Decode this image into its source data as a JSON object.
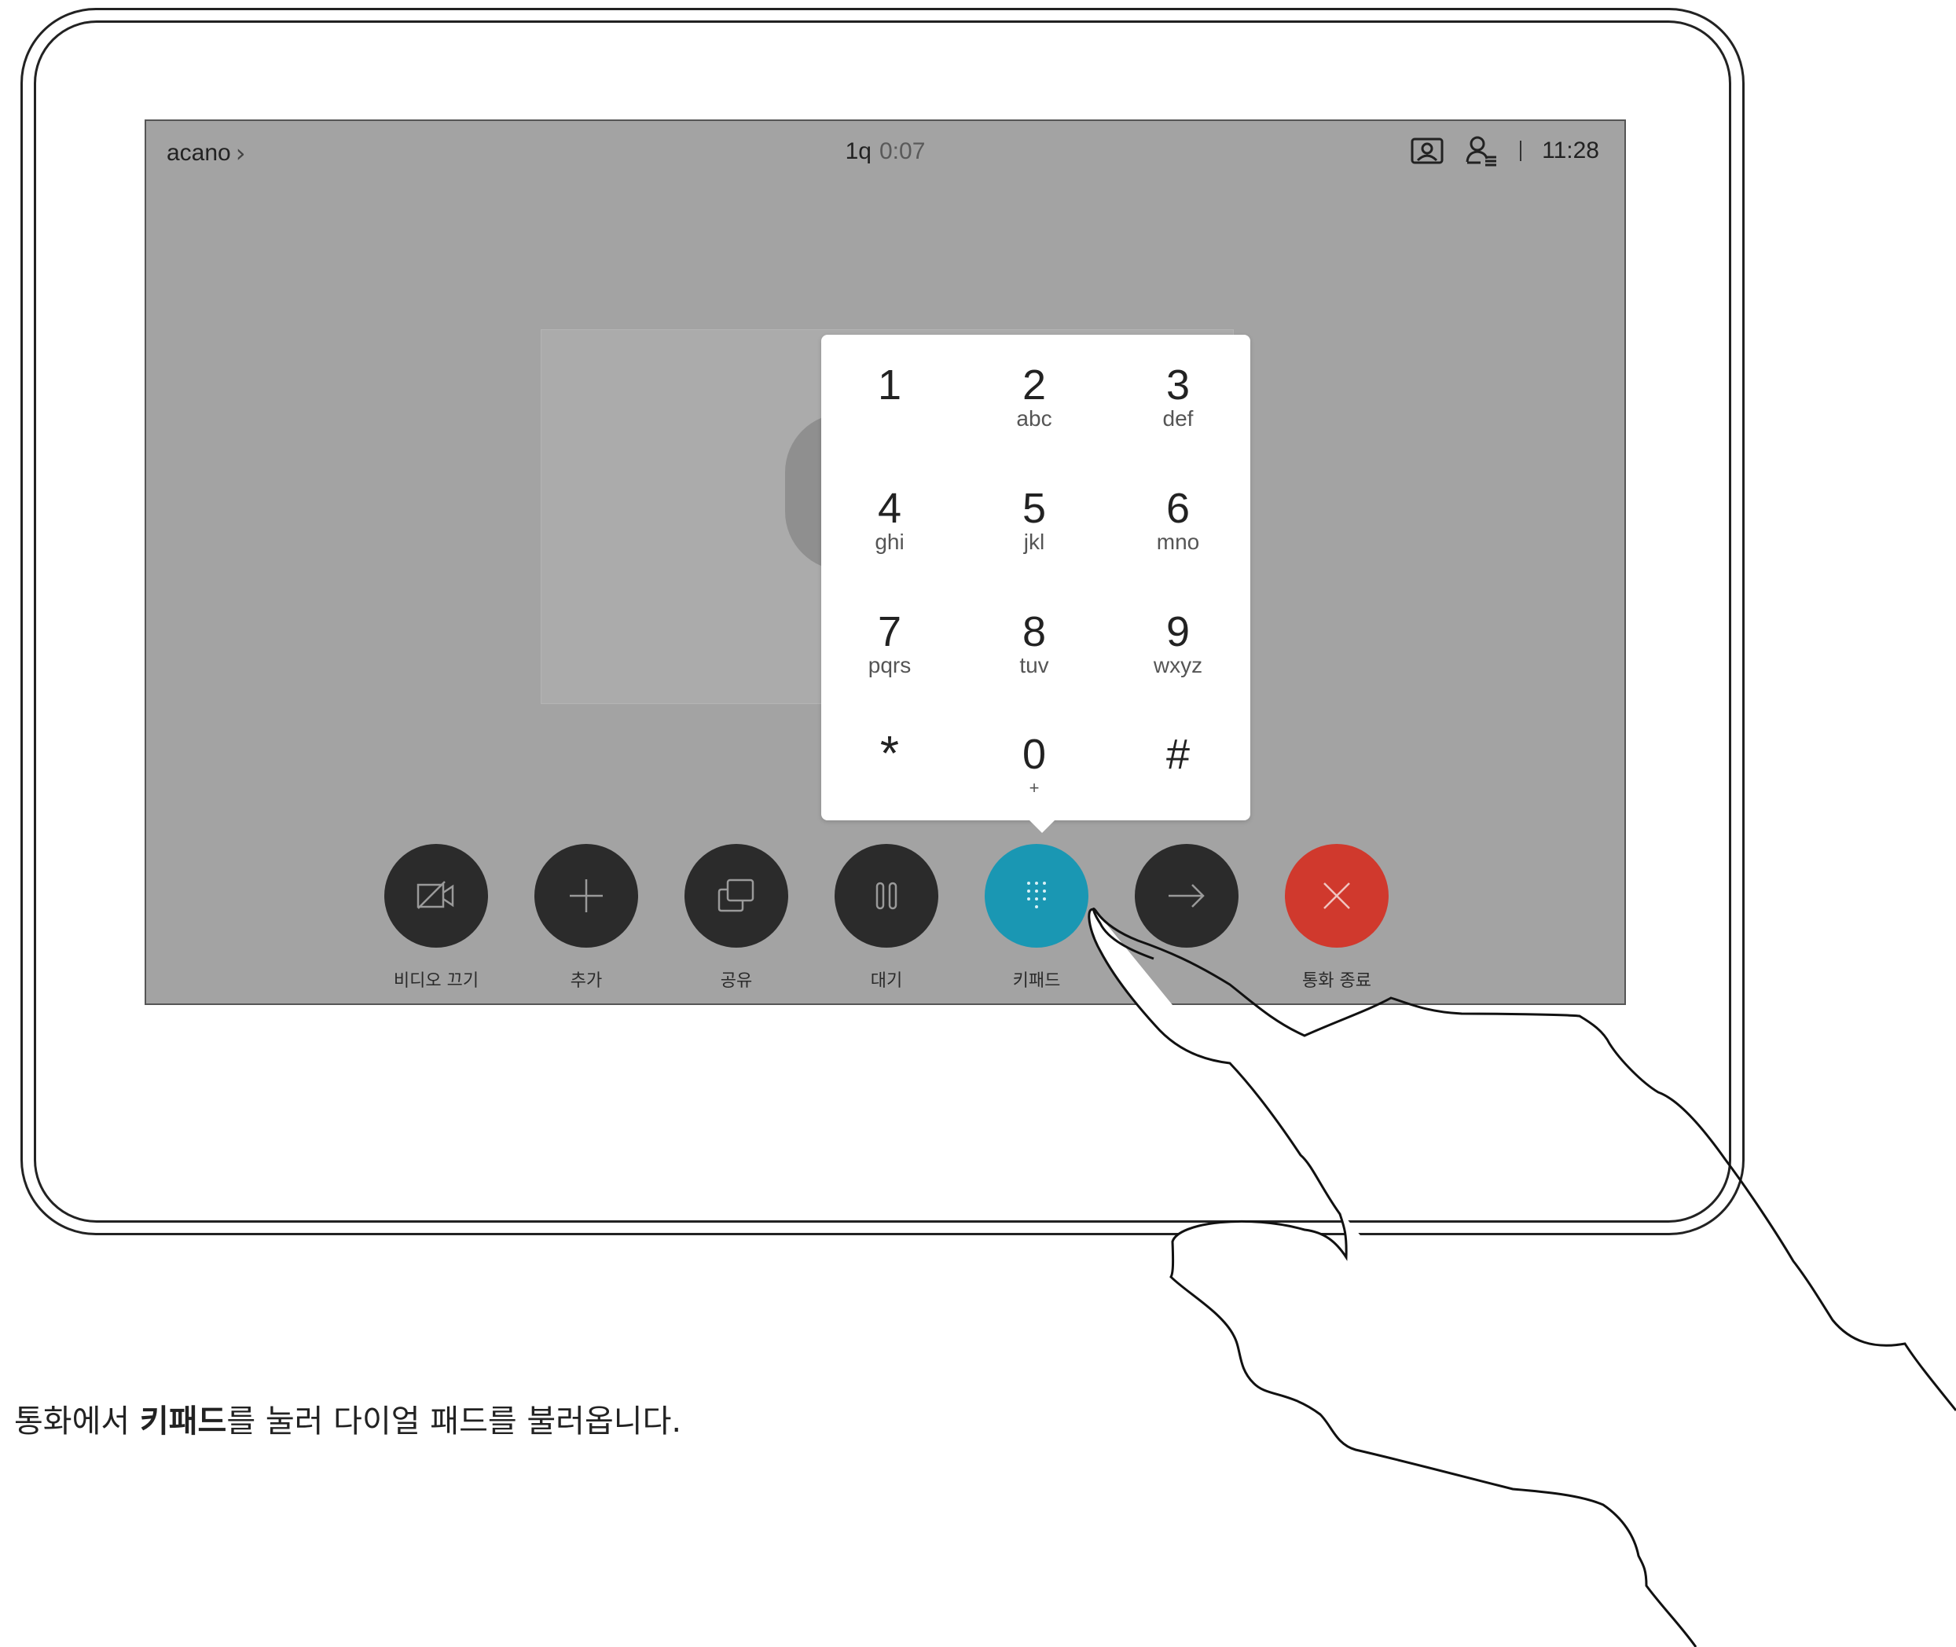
{
  "status_bar": {
    "meeting_name": "acano",
    "call_id": "1q",
    "call_timer": "0:07",
    "clock": "11:28",
    "icons": [
      "self-view-icon",
      "participants-icon"
    ]
  },
  "keypad": {
    "keys": [
      {
        "digit": "1",
        "letters": ""
      },
      {
        "digit": "2",
        "letters": "abc"
      },
      {
        "digit": "3",
        "letters": "def"
      },
      {
        "digit": "4",
        "letters": "ghi"
      },
      {
        "digit": "5",
        "letters": "jkl"
      },
      {
        "digit": "6",
        "letters": "mno"
      },
      {
        "digit": "7",
        "letters": "pqrs"
      },
      {
        "digit": "8",
        "letters": "tuv"
      },
      {
        "digit": "9",
        "letters": "wxyz"
      },
      {
        "digit": "*",
        "letters": ""
      },
      {
        "digit": "0",
        "letters": "+"
      },
      {
        "digit": "#",
        "letters": ""
      }
    ]
  },
  "controls": {
    "video_off": "비디오 끄기",
    "add": "추가",
    "share": "공유",
    "hold": "대기",
    "keypad": "키패드",
    "transfer": "",
    "end_call": "통화 종료"
  },
  "colors": {
    "screen_bg": "#a3a3a3",
    "button_dark": "#2b2b2b",
    "keypad_active": "#1a97b3",
    "end_call": "#d0392d"
  },
  "caption": {
    "prefix": "통화에서 ",
    "bold": "키패드",
    "suffix": "를 눌러 다이얼 패드를 불러옵니다."
  }
}
